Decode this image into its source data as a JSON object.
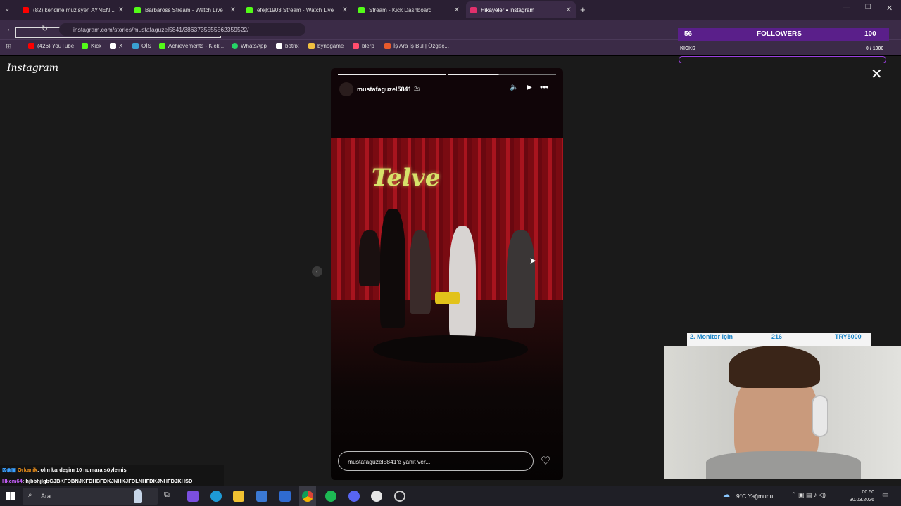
{
  "tabs": [
    {
      "title": "(82) kendine müzisyen AYNEN ...",
      "icon_color": "#ff0000"
    },
    {
      "title": "Barbaross Stream - Watch Live",
      "icon_color": "#53fc18"
    },
    {
      "title": "efejk1903 Stream - Watch Live",
      "icon_color": "#53fc18"
    },
    {
      "title": "Stream - Kick Dashboard",
      "icon_color": "#53fc18"
    },
    {
      "title": "Hikayeler • Instagram",
      "icon_color": "#e1306c"
    }
  ],
  "url": "instagram.com/stories/mustafaguzel5841/3863735555562359522/",
  "bookmarks": [
    {
      "label": "(426) YouTube",
      "icon_color": "#ff0000"
    },
    {
      "label": "Kick",
      "icon_color": "#53fc18"
    },
    {
      "label": "X",
      "icon_color": "#ffffff"
    },
    {
      "label": "OİS",
      "icon_color": "#3aa0d0"
    },
    {
      "label": "Achievements - Kick...",
      "icon_color": "#53fc18"
    },
    {
      "label": "WhatsApp",
      "icon_color": "#25d366"
    },
    {
      "label": "botrix",
      "icon_color": "#ffffff"
    },
    {
      "label": "bynogame",
      "icon_color": "#f0c040"
    },
    {
      "label": "blerp",
      "icon_color": "#ff4d6d"
    },
    {
      "label": "İş Ara İş Bul | Özgeç...",
      "icon_color": "#e85a2c"
    }
  ],
  "instagram": {
    "logo": "Instagram",
    "close": "✕"
  },
  "story": {
    "username": "mustafaguzel5841",
    "time": "2s",
    "sign": "Telve",
    "reply_placeholder": "mustafaguzel5841'e yanıt ver..."
  },
  "overlay": {
    "followers_count": "56",
    "followers_label": "FOLLOWERS",
    "followers_goal": "100",
    "kicks_label": "KICKS",
    "kicks_value": "0 / 1000"
  },
  "cam_label": {
    "title": "2. Monitor için",
    "count": "216",
    "price": "TRY5000"
  },
  "chat": [
    {
      "user": "Orkanik",
      "text": ": olm kardeşim 10 numara söylemiş",
      "color": "#ff9a1a"
    },
    {
      "user": "Hkcm64",
      "text": ": hjbbhjlgbGJBKFDBNJKFDHBFDKJNHKJFDLNHFDKJNHFDJKHSD",
      "color": "#c860ff"
    }
  ],
  "taskbar": {
    "search_label": "Ara",
    "weather": "9°C  Yağmurlu",
    "time": "00:50",
    "date": "30.03.2026"
  }
}
